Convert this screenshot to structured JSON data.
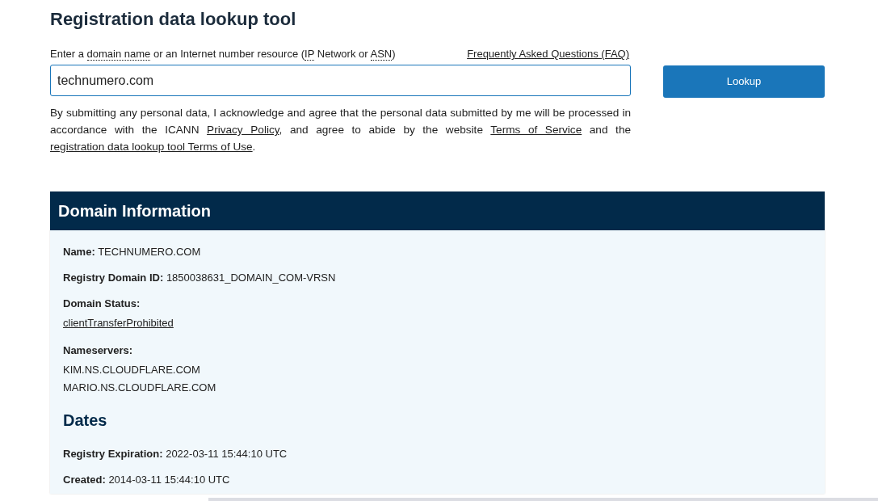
{
  "title": "Registration data lookup tool",
  "search": {
    "label_parts": [
      {
        "text": "Enter a ",
        "abbr": false
      },
      {
        "text": "domain name",
        "abbr": true
      },
      {
        "text": " or an Internet number resource (",
        "abbr": false
      },
      {
        "text": "IP",
        "abbr": true
      },
      {
        "text": " Network or ",
        "abbr": false
      },
      {
        "text": "ASN",
        "abbr": true
      },
      {
        "text": ")",
        "abbr": false
      }
    ],
    "faq_link": "Frequently Asked Questions (FAQ)",
    "value": "technumero.com",
    "button": "Lookup"
  },
  "consent_parts": [
    {
      "text": "By submitting any personal data, I acknowledge and agree that the personal data submitted by me will be processed in accordance with the ICANN ",
      "link": false
    },
    {
      "text": "Privacy Policy",
      "link": true
    },
    {
      "text": ", and agree to abide by the website ",
      "link": false
    },
    {
      "text": "Terms of Service",
      "link": true
    },
    {
      "text": " and the ",
      "link": false
    },
    {
      "text": "registration data lookup tool Terms of Use",
      "link": true
    },
    {
      "text": ".",
      "link": false
    }
  ],
  "panel": {
    "header": "Domain Information",
    "sections": [
      {
        "fields": [
          {
            "kind": "inline",
            "label": "Name:",
            "values": [
              {
                "text": "TECHNUMERO.COM",
                "link": false
              }
            ]
          },
          {
            "kind": "inline",
            "label": "Registry Domain ID:",
            "values": [
              {
                "text": "1850038631_DOMAIN_COM-VRSN",
                "link": false
              }
            ]
          },
          {
            "kind": "block",
            "label": "Domain Status:",
            "values": [
              {
                "text": "clientTransferProhibited",
                "link": true
              }
            ]
          },
          {
            "kind": "block",
            "label": "Nameservers:",
            "values": [
              {
                "text": "KIM.NS.CLOUDFLARE.COM",
                "link": false
              },
              {
                "text": "MARIO.NS.CLOUDFLARE.COM",
                "link": false
              }
            ]
          }
        ]
      },
      {
        "heading": "Dates",
        "fields": [
          {
            "kind": "inline",
            "label": "Registry Expiration:",
            "values": [
              {
                "text": "2022-03-11 15:44:10 UTC",
                "link": false
              }
            ]
          },
          {
            "kind": "inline",
            "label": "Created:",
            "values": [
              {
                "text": "2014-03-11 15:44:10 UTC",
                "link": false
              }
            ]
          }
        ]
      }
    ]
  }
}
